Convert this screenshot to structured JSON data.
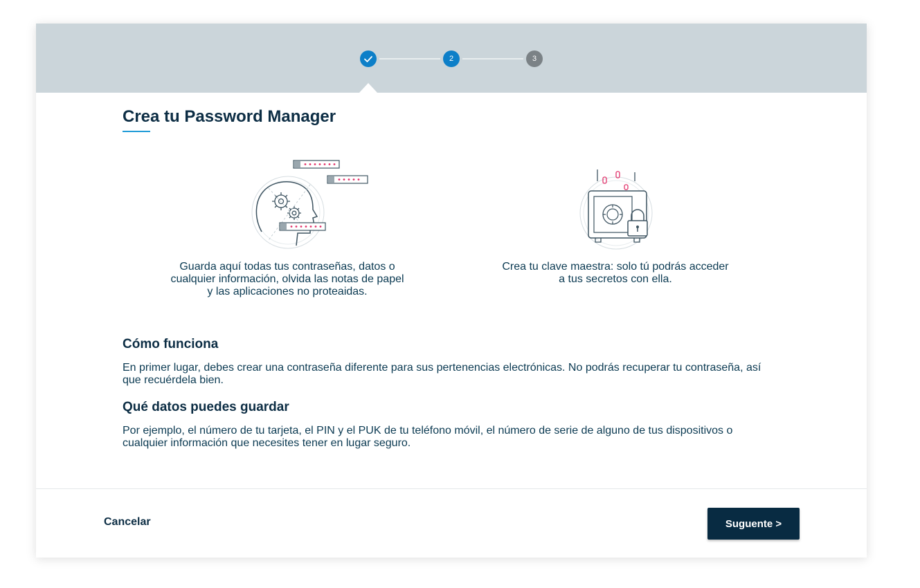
{
  "stepper": {
    "steps": [
      {
        "label": "",
        "state": "completed",
        "icon": "check-icon"
      },
      {
        "label": "2",
        "state": "active"
      },
      {
        "label": "3",
        "state": "pending"
      }
    ],
    "colors": {
      "active": "#0d7fc8",
      "pending": "#7b8286",
      "bar": "#cbd5da"
    }
  },
  "header": {
    "title": "Crea tu Password Manager"
  },
  "features": [
    {
      "icon": "head-gears-passwords-icon",
      "text": "Guarda aquí todas tus contraseñas, datos o cualquier información, olvida las notas de papel y las aplicaciones no proteaidas."
    },
    {
      "icon": "safe-lock-icon",
      "text": "Crea tu clave maestra: solo tú podrás acceder a tus secretos con ella."
    }
  ],
  "sections": [
    {
      "title": "Cómo funciona",
      "text": "En primer lugar, debes crear una contraseña diferente para sus pertenencias electrónicas. No podrás recuperar tu contraseña, así que recuérdela bien."
    },
    {
      "title": "Qué datos puedes guardar",
      "text": "Por ejemplo, el número de tu tarjeta, el PIN y el PUK de tu teléfono móvil, el número de serie de alguno de tus dispositivos o cualquier información que necesites tener en lugar seguro."
    }
  ],
  "footer": {
    "cancel_label": "Cancelar",
    "next_label": "Suguente >"
  }
}
